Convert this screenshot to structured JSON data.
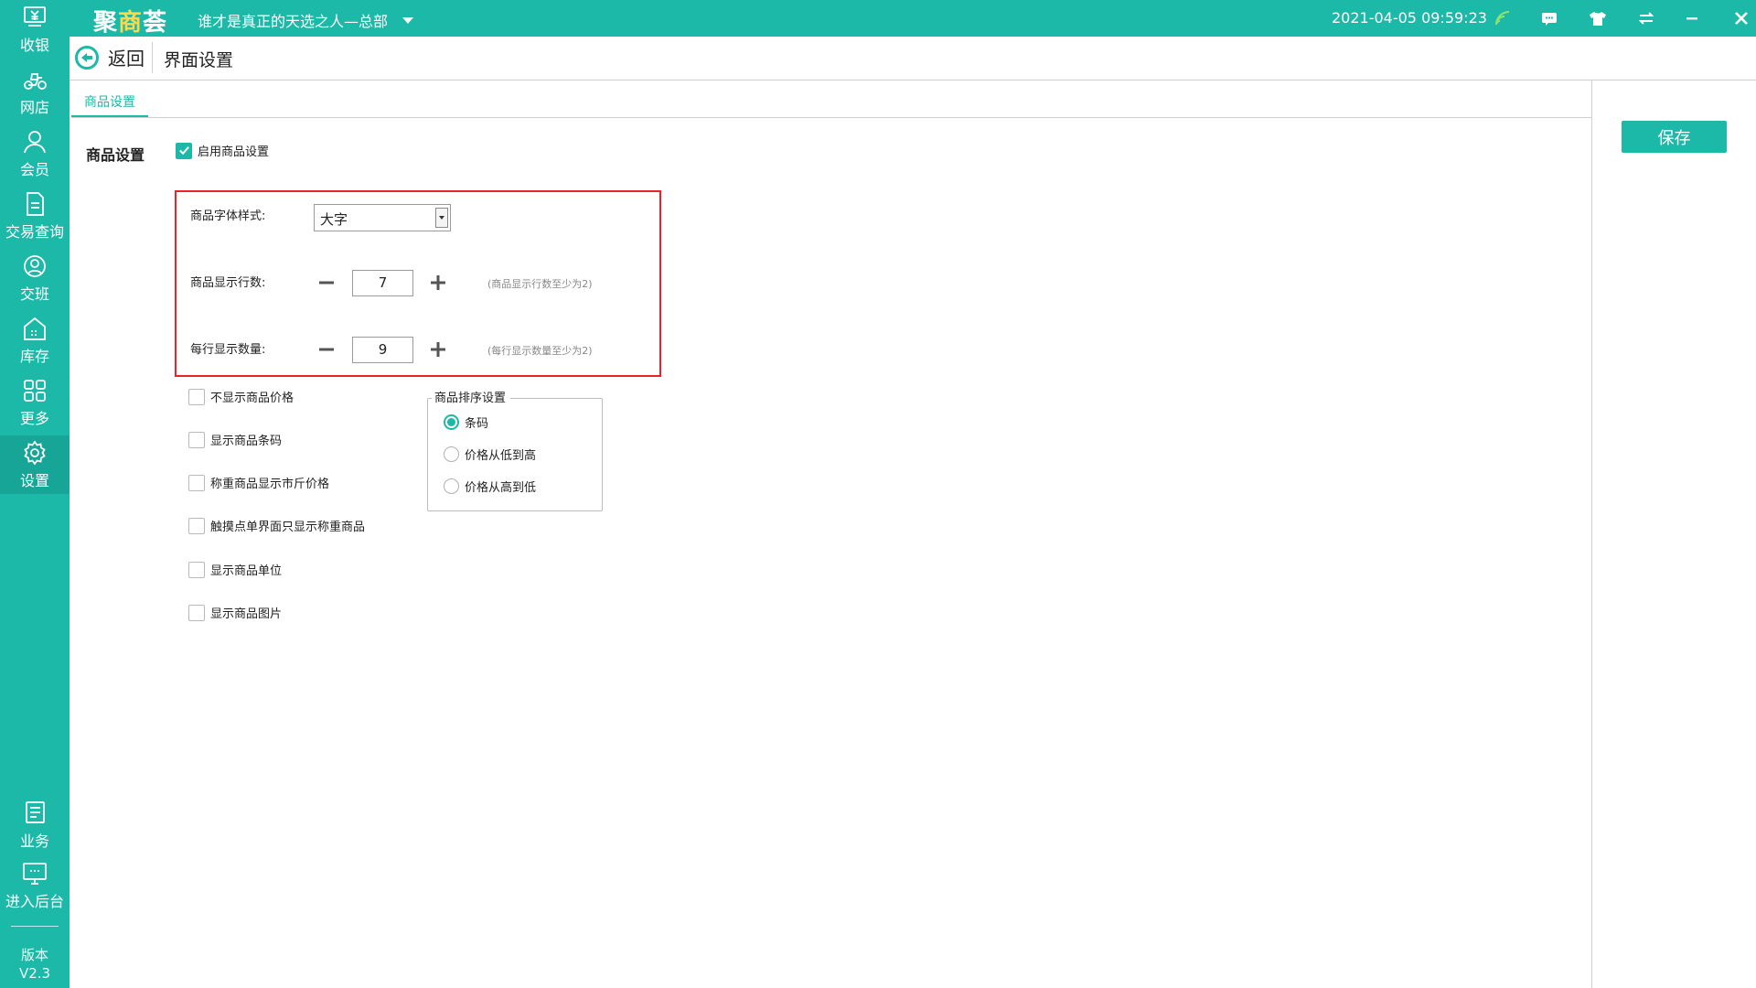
{
  "app": {
    "brand_left": "聚",
    "brand_mid": "商",
    "brand_right": "荟",
    "store_name": "谁才是真正的天选之人—总部",
    "datetime": "2021-04-05 09:59:23",
    "accent_color": "#1cb8a8"
  },
  "sidebar": {
    "items": [
      {
        "label": "收银",
        "icon": "cash-register-icon"
      },
      {
        "label": "网店",
        "icon": "delivery-bike-icon"
      },
      {
        "label": "会员",
        "icon": "member-icon"
      },
      {
        "label": "交易查询",
        "icon": "document-icon"
      },
      {
        "label": "交班",
        "icon": "shift-user-icon"
      },
      {
        "label": "库存",
        "icon": "warehouse-icon"
      },
      {
        "label": "更多",
        "icon": "grid-icon"
      },
      {
        "label": "设置",
        "icon": "gear-icon"
      }
    ],
    "bottom_items": [
      {
        "label": "业务",
        "icon": "business-book-icon"
      },
      {
        "label": "进入后台",
        "icon": "monitor-icon"
      }
    ],
    "version_label": "版本",
    "version_value": "V2.3"
  },
  "topbar_icons": [
    "wifi-signal-icon",
    "message-icon",
    "shirt-icon",
    "sync-arrows-icon",
    "minimize-icon",
    "close-icon"
  ],
  "header": {
    "back_label": "返回",
    "page_title": "界面设置"
  },
  "tabs": [
    "商品设置"
  ],
  "toolbar": {
    "save_label": "保存"
  },
  "content": {
    "section_title": "商品设置",
    "enable_label": "启用商品设置",
    "enable_checked": true,
    "font_style_label": "商品字体样式:",
    "font_style_value": "大字",
    "rows_label": "商品显示行数:",
    "rows_value": "7",
    "rows_hint": "(商品显示行数至少为2)",
    "per_row_label": "每行显示数量:",
    "per_row_value": "9",
    "per_row_hint": "(每行显示数量至少为2)",
    "options": [
      {
        "label": "不显示商品价格",
        "checked": false
      },
      {
        "label": "显示商品条码",
        "checked": false
      },
      {
        "label": "称重商品显示市斤价格",
        "checked": false
      },
      {
        "label": "触摸点单界面只显示称重商品",
        "checked": false
      },
      {
        "label": "显示商品单位",
        "checked": false
      },
      {
        "label": "显示商品图片",
        "checked": false
      }
    ],
    "sort_group_title": "商品排序设置",
    "sort_options": [
      {
        "label": "条码",
        "selected": true
      },
      {
        "label": "价格从低到高",
        "selected": false
      },
      {
        "label": "价格从高到低",
        "selected": false
      }
    ]
  }
}
